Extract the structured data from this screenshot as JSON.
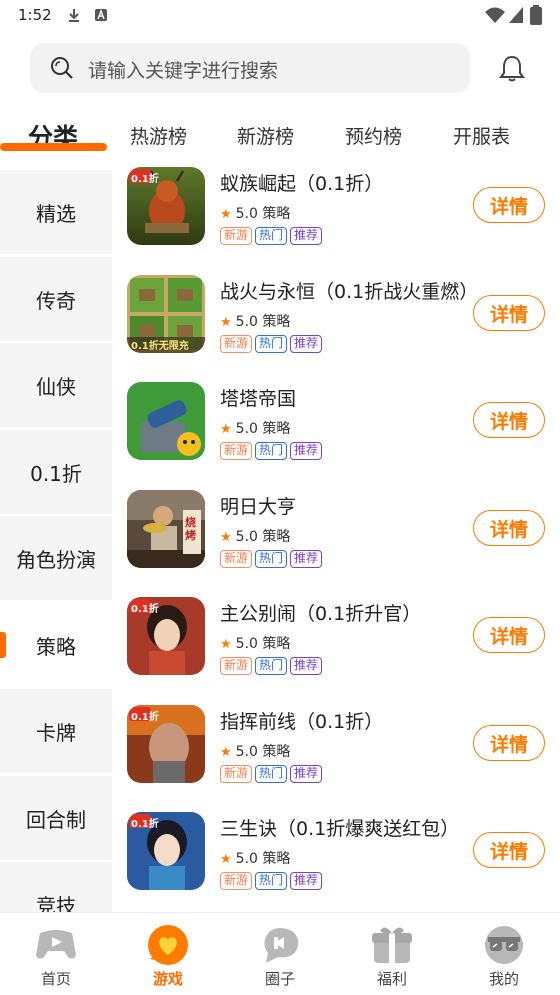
{
  "status_bar": {
    "time": "1:52",
    "icons": [
      "download-icon",
      "a-box-icon",
      "wifi-icon",
      "signal-icon",
      "battery-icon"
    ]
  },
  "search": {
    "placeholder": "请输入关键字进行搜索"
  },
  "tabs": [
    {
      "label": "分类",
      "active": true
    },
    {
      "label": "热游榜",
      "active": false
    },
    {
      "label": "新游榜",
      "active": false
    },
    {
      "label": "预约榜",
      "active": false
    },
    {
      "label": "开服表",
      "active": false
    }
  ],
  "sidebar": [
    {
      "label": "精选"
    },
    {
      "label": "传奇"
    },
    {
      "label": "仙侠"
    },
    {
      "label": "0.1折"
    },
    {
      "label": "角色扮演"
    },
    {
      "label": "策略",
      "active": true
    },
    {
      "label": "卡牌"
    },
    {
      "label": "回合制"
    },
    {
      "label": "竞技"
    }
  ],
  "games": [
    {
      "name": "蚁族崛起（0.1折）",
      "rating": "5.0",
      "category": "策略",
      "tags": [
        "新游",
        "热门",
        "推荐"
      ],
      "action": "详情",
      "icon": "ant-warrior-icon",
      "icon_badge": "0.1折"
    },
    {
      "name": "战火与永恒（0.1折战火重燃）",
      "rating": "5.0",
      "category": "策略",
      "tags": [
        "新游",
        "热门",
        "推荐"
      ],
      "action": "详情",
      "icon": "war-grid-icon",
      "icon_badge": "0.1折无限充"
    },
    {
      "name": "塔塔帝国",
      "rating": "5.0",
      "category": "策略",
      "tags": [
        "新游",
        "热门",
        "推荐"
      ],
      "action": "详情",
      "icon": "cannon-tower-icon",
      "icon_badge": ""
    },
    {
      "name": "明日大亨",
      "rating": "5.0",
      "category": "策略",
      "tags": [
        "新游",
        "热门",
        "推荐"
      ],
      "action": "详情",
      "icon": "street-vendor-icon",
      "icon_badge": "烧烤"
    },
    {
      "name": "主公别闹（0.1折升官）",
      "rating": "5.0",
      "category": "策略",
      "tags": [
        "新游",
        "热门",
        "推荐"
      ],
      "action": "详情",
      "icon": "lady-portrait-icon",
      "icon_badge": "0.1折"
    },
    {
      "name": "指挥前线（0.1折）",
      "rating": "5.0",
      "category": "策略",
      "tags": [
        "新游",
        "热门",
        "推荐"
      ],
      "action": "详情",
      "icon": "commander-portrait-icon",
      "icon_badge": "0.1折"
    },
    {
      "name": "三生诀（0.1折爆爽送红包）",
      "rating": "5.0",
      "category": "策略",
      "tags": [
        "新游",
        "热门",
        "推荐"
      ],
      "action": "详情",
      "icon": "fairy-portrait-icon",
      "icon_badge": "0.1折"
    }
  ],
  "bottom_nav": [
    {
      "label": "首页",
      "icon": "gamepad-icon"
    },
    {
      "label": "游戏",
      "icon": "heart-chat-icon",
      "active": true
    },
    {
      "label": "圈子",
      "icon": "chat-bubble-icon"
    },
    {
      "label": "福利",
      "icon": "gift-icon"
    },
    {
      "label": "我的",
      "icon": "glasses-face-icon"
    }
  ],
  "colors": {
    "accent": "#ff6a00",
    "tag_new": "#ff7a4a",
    "tag_hot": "#2f6fe0",
    "tag_rec": "#7a3fd8"
  }
}
